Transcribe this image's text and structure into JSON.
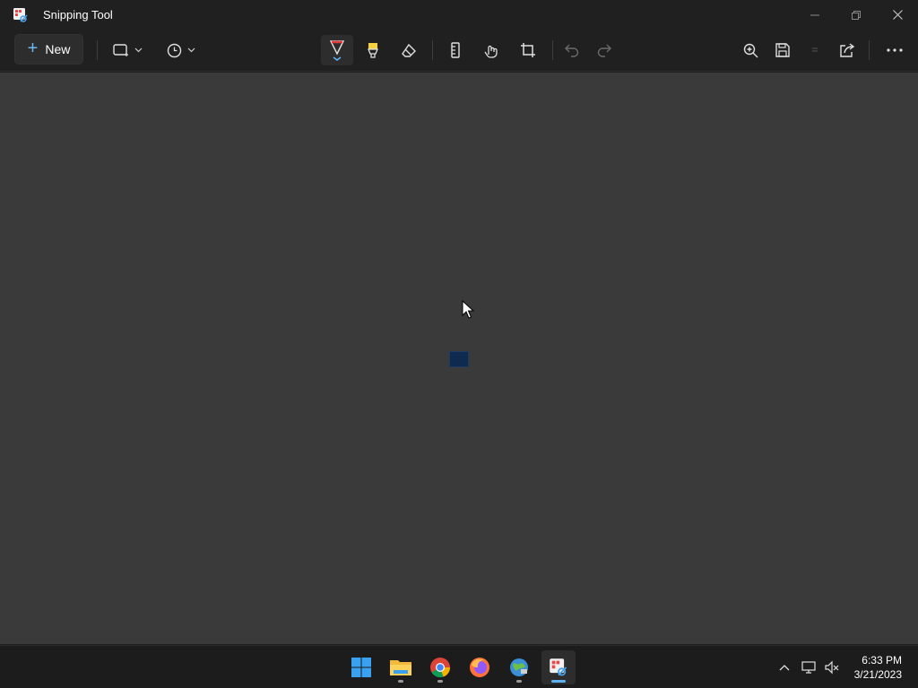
{
  "window": {
    "title": "Snipping Tool",
    "icon": "snipping-tool-icon",
    "controls": [
      "minimize-icon",
      "restore-icon",
      "close-icon"
    ]
  },
  "toolbar": {
    "new_label": "New",
    "snip_mode_icon": "rectangle-snip-icon",
    "delay_icon": "clock-icon",
    "tools": [
      "ballpoint-pen-icon",
      "highlighter-icon",
      "eraser-icon",
      "ruler-icon",
      "touch-writing-icon",
      "crop-icon",
      "undo-icon",
      "redo-icon",
      "zoom-icon",
      "save-icon",
      "copy-icon",
      "share-icon",
      "more-icon"
    ],
    "active_tool": "ballpoint-pen",
    "colors": {
      "pen": "#e23a3a",
      "highlighter": "#f5d23a",
      "accent": "#5fb2f2"
    }
  },
  "taskbar": {
    "apps": [
      "start",
      "file-explorer",
      "chrome",
      "firefox",
      "control-panel",
      "snipping-tool"
    ],
    "active_app": "snipping-tool",
    "clock": {
      "time": "6:33 PM",
      "date": "3/21/2023"
    }
  }
}
